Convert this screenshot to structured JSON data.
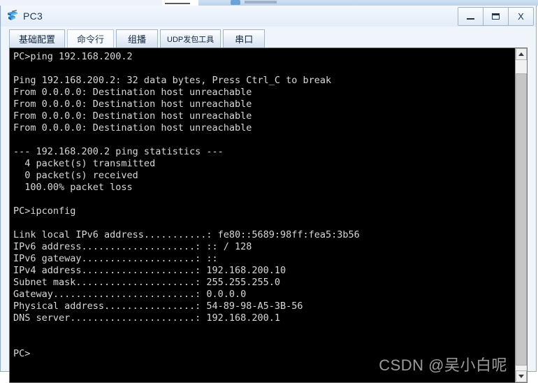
{
  "window": {
    "title": "PC3",
    "icon": "pc-device-icon",
    "controls": {
      "minimize_label": "_",
      "maximize_label": "□",
      "close_label": "X"
    }
  },
  "tabs": [
    {
      "label": "基础配置",
      "active": false
    },
    {
      "label": "命令行",
      "active": true
    },
    {
      "label": "组播",
      "active": false
    },
    {
      "label": "UDP发包工具",
      "active": false,
      "small": true
    },
    {
      "label": "串口",
      "active": false
    }
  ],
  "terminal": {
    "background": "#000000",
    "foreground": "#d8d8dc",
    "lines": [
      "PC>ping 192.168.200.2",
      "",
      "Ping 192.168.200.2: 32 data bytes, Press Ctrl_C to break",
      "From 0.0.0.0: Destination host unreachable",
      "From 0.0.0.0: Destination host unreachable",
      "From 0.0.0.0: Destination host unreachable",
      "From 0.0.0.0: Destination host unreachable",
      "",
      "--- 192.168.200.2 ping statistics ---",
      "  4 packet(s) transmitted",
      "  0 packet(s) received",
      "  100.00% packet loss",
      "",
      "PC>ipconfig",
      "",
      "Link local IPv6 address...........: fe80::5689:98ff:fea5:3b56",
      "IPv6 address....................: :: / 128",
      "IPv6 gateway....................: ::",
      "IPv4 address....................: 192.168.200.10",
      "Subnet mask.....................: 255.255.255.0",
      "Gateway.........................: 0.0.0.0",
      "Physical address................: 54-89-98-A5-3B-56",
      "DNS server......................: 192.168.200.1",
      "",
      "",
      "PC>"
    ]
  },
  "scrollbar": {
    "up_arrow": "scroll-up",
    "down_arrow": "scroll-down"
  },
  "watermark": {
    "text": "CSDN @吴小白呢"
  }
}
